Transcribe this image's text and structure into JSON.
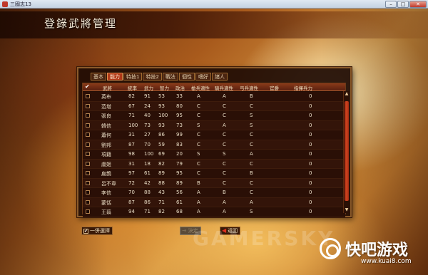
{
  "window": {
    "title": "三國志13"
  },
  "header": {
    "title": "登錄武將管理"
  },
  "tabs": [
    {
      "label": "基本",
      "active": false
    },
    {
      "label": "能力",
      "active": true
    },
    {
      "label": "特技1",
      "active": false
    },
    {
      "label": "特技2",
      "active": false
    },
    {
      "label": "戰法",
      "active": false
    },
    {
      "label": "個性",
      "active": false
    },
    {
      "label": "嗜好",
      "active": false
    },
    {
      "label": "諸人",
      "active": false
    }
  ],
  "table": {
    "headers": [
      "武將",
      "統率",
      "武力",
      "智力",
      "政治",
      "槍兵適性",
      "騎兵適性",
      "弓兵適性",
      "官爵",
      "指揮兵力"
    ],
    "rows": [
      [
        "英布",
        "82",
        "91",
        "53",
        "33",
        "A",
        "A",
        "B",
        "",
        "0"
      ],
      [
        "范增",
        "67",
        "24",
        "93",
        "80",
        "C",
        "C",
        "C",
        "",
        "0"
      ],
      [
        "張良",
        "71",
        "40",
        "100",
        "95",
        "C",
        "C",
        "S",
        "",
        "0"
      ],
      [
        "韓信",
        "100",
        "73",
        "93",
        "73",
        "S",
        "A",
        "S",
        "",
        "0"
      ],
      [
        "蕭何",
        "31",
        "27",
        "86",
        "99",
        "C",
        "C",
        "C",
        "",
        "0"
      ],
      [
        "劉邦",
        "87",
        "70",
        "59",
        "83",
        "C",
        "C",
        "C",
        "",
        "0"
      ],
      [
        "項籍",
        "98",
        "100",
        "69",
        "20",
        "S",
        "S",
        "A",
        "",
        "0"
      ],
      [
        "虞姬",
        "31",
        "18",
        "82",
        "79",
        "C",
        "C",
        "C",
        "",
        "0"
      ],
      [
        "扁鵲",
        "97",
        "61",
        "89",
        "95",
        "C",
        "C",
        "B",
        "",
        "0"
      ],
      [
        "呂不韋",
        "72",
        "42",
        "88",
        "89",
        "B",
        "C",
        "C",
        "",
        "0"
      ],
      [
        "李信",
        "70",
        "88",
        "43",
        "56",
        "A",
        "B",
        "C",
        "",
        "0"
      ],
      [
        "蒙恬",
        "87",
        "86",
        "71",
        "61",
        "A",
        "A",
        "A",
        "",
        "0"
      ],
      [
        "王翦",
        "94",
        "71",
        "82",
        "68",
        "A",
        "A",
        "S",
        "",
        "0"
      ]
    ]
  },
  "buttons": {
    "select_all": "一併選擇",
    "decide": "決定",
    "back": "返回"
  },
  "watermark": "GAMERSKY",
  "site": {
    "name": "快吧游戏",
    "url": "www.kuai8.com"
  }
}
